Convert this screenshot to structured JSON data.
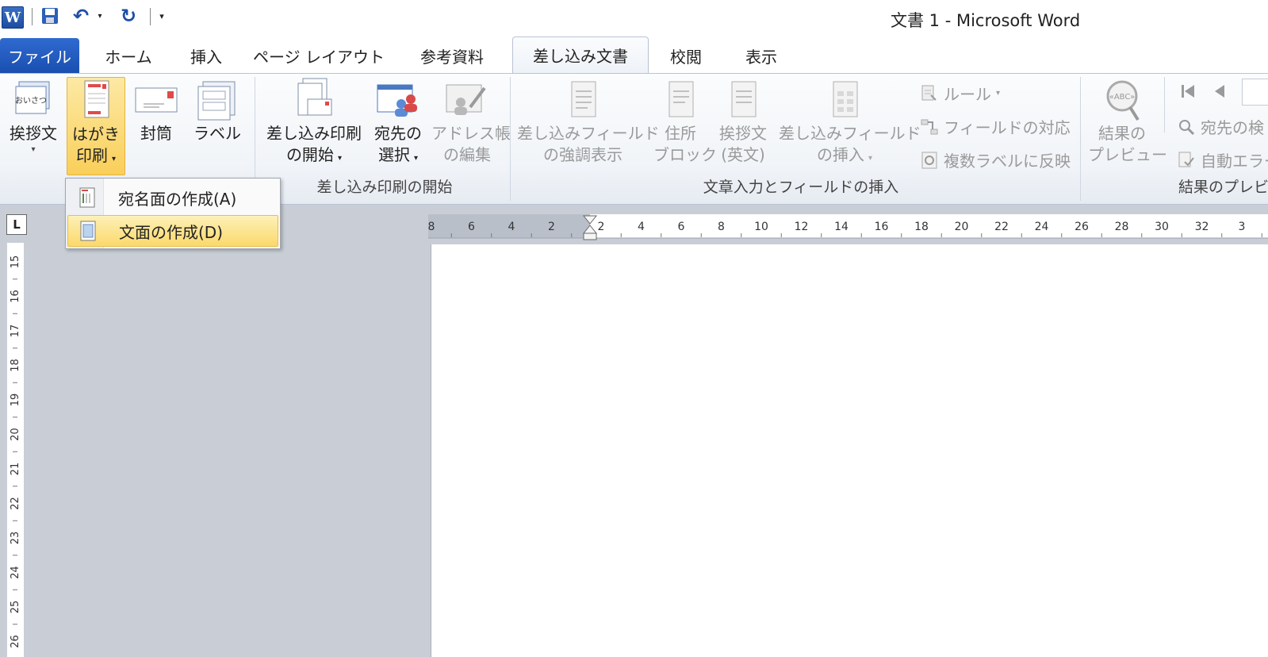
{
  "window": {
    "title": "文書 1 - Microsoft Word"
  },
  "quick_access": {
    "logo": "W",
    "undo": "↶",
    "redo": "↻",
    "dropdown": "▾",
    "customize": "▾"
  },
  "tabs": [
    {
      "label": "ファイル"
    },
    {
      "label": "ホーム"
    },
    {
      "label": "挿入"
    },
    {
      "label": "ページ レイアウト"
    },
    {
      "label": "参考資料"
    },
    {
      "label": "差し込み文書"
    },
    {
      "label": "校閲"
    },
    {
      "label": "表示"
    }
  ],
  "ribbon": {
    "groups": {
      "create": {
        "greeting": {
          "line1": "挨拶文"
        },
        "postcard": {
          "line1": "はがき",
          "line2": "印刷"
        },
        "envelope": {
          "line1": "封筒"
        },
        "labels": {
          "line1": "ラベル"
        },
        "greeting_icon_text": "おいさつ"
      },
      "start_merge": {
        "label": "差し込み印刷の開始",
        "start": {
          "line1": "差し込み印刷",
          "line2": "の開始"
        },
        "recipients": {
          "line1": "宛先の",
          "line2": "選択"
        },
        "edit_list": {
          "line1": "アドレス帳",
          "line2": "の編集"
        }
      },
      "write_insert": {
        "label": "文章入力とフィールドの挿入",
        "highlight": {
          "line1": "差し込みフィールド",
          "line2": "の強調表示"
        },
        "address_block": {
          "line1": "住所",
          "line2": "ブロック"
        },
        "greeting_line": {
          "line1": "挨拶文",
          "line2": "(英文)"
        },
        "insert_field": {
          "line1": "差し込みフィールド",
          "line2": "の挿入"
        },
        "rules": "ルール",
        "match_fields": "フィールドの対応",
        "update_labels": "複数ラベルに反映"
      },
      "preview": {
        "label": "結果のプレビュー",
        "preview_results": {
          "line1": "結果の",
          "line2": "プレビュー"
        },
        "find_recipient": "宛先の検",
        "auto_check": "自動エラー",
        "preview_icon_text": "«ABC»"
      }
    }
  },
  "postcard_menu": {
    "items": [
      {
        "label": "宛名面の作成(A)"
      },
      {
        "label": "文面の作成(D)"
      }
    ]
  },
  "hruler": {
    "numbers": [
      "8",
      "6",
      "4",
      "2",
      "2",
      "4",
      "6",
      "8",
      "10",
      "12",
      "14",
      "16",
      "18",
      "20",
      "22",
      "24",
      "26",
      "28",
      "30",
      "32",
      "3"
    ]
  },
  "vruler": {
    "numbers": [
      "15",
      "16",
      "17",
      "18",
      "19",
      "20",
      "21",
      "22",
      "23",
      "24",
      "25",
      "26"
    ]
  },
  "ruler_corner": "L"
}
